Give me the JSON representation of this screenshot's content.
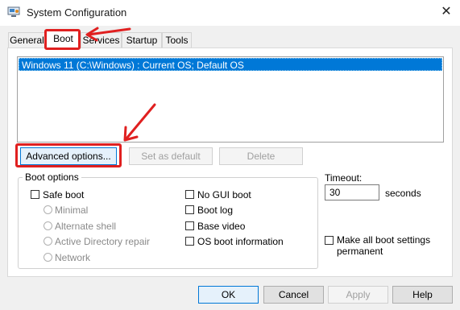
{
  "window": {
    "title": "System Configuration",
    "close_glyph": "✕",
    "app_icon": "monitor-settings-icon"
  },
  "tabs": [
    {
      "label": "General"
    },
    {
      "label": "Boot",
      "active": true
    },
    {
      "label": "Services"
    },
    {
      "label": "Startup"
    },
    {
      "label": "Tools"
    }
  ],
  "boot_list": {
    "items": [
      "Windows 11 (C:\\Windows) : Current OS; Default OS"
    ]
  },
  "list_buttons": {
    "advanced": "Advanced options...",
    "set_default": "Set as default",
    "delete": "Delete"
  },
  "boot_options": {
    "title": "Boot options",
    "safe_boot": "Safe boot",
    "minimal": "Minimal",
    "alternate_shell": "Alternate shell",
    "active_directory_repair": "Active Directory repair",
    "network": "Network",
    "no_gui_boot": "No GUI boot",
    "boot_log": "Boot log",
    "base_video": "Base video",
    "os_boot_information": "OS boot information"
  },
  "timeout": {
    "label": "Timeout:",
    "value": "30",
    "unit": "seconds"
  },
  "make_permanent": "Make all boot settings permanent",
  "footer": {
    "ok": "OK",
    "cancel": "Cancel",
    "apply": "Apply",
    "help": "Help"
  },
  "colors": {
    "annotation": "#e02020",
    "selection": "#0078d7"
  }
}
